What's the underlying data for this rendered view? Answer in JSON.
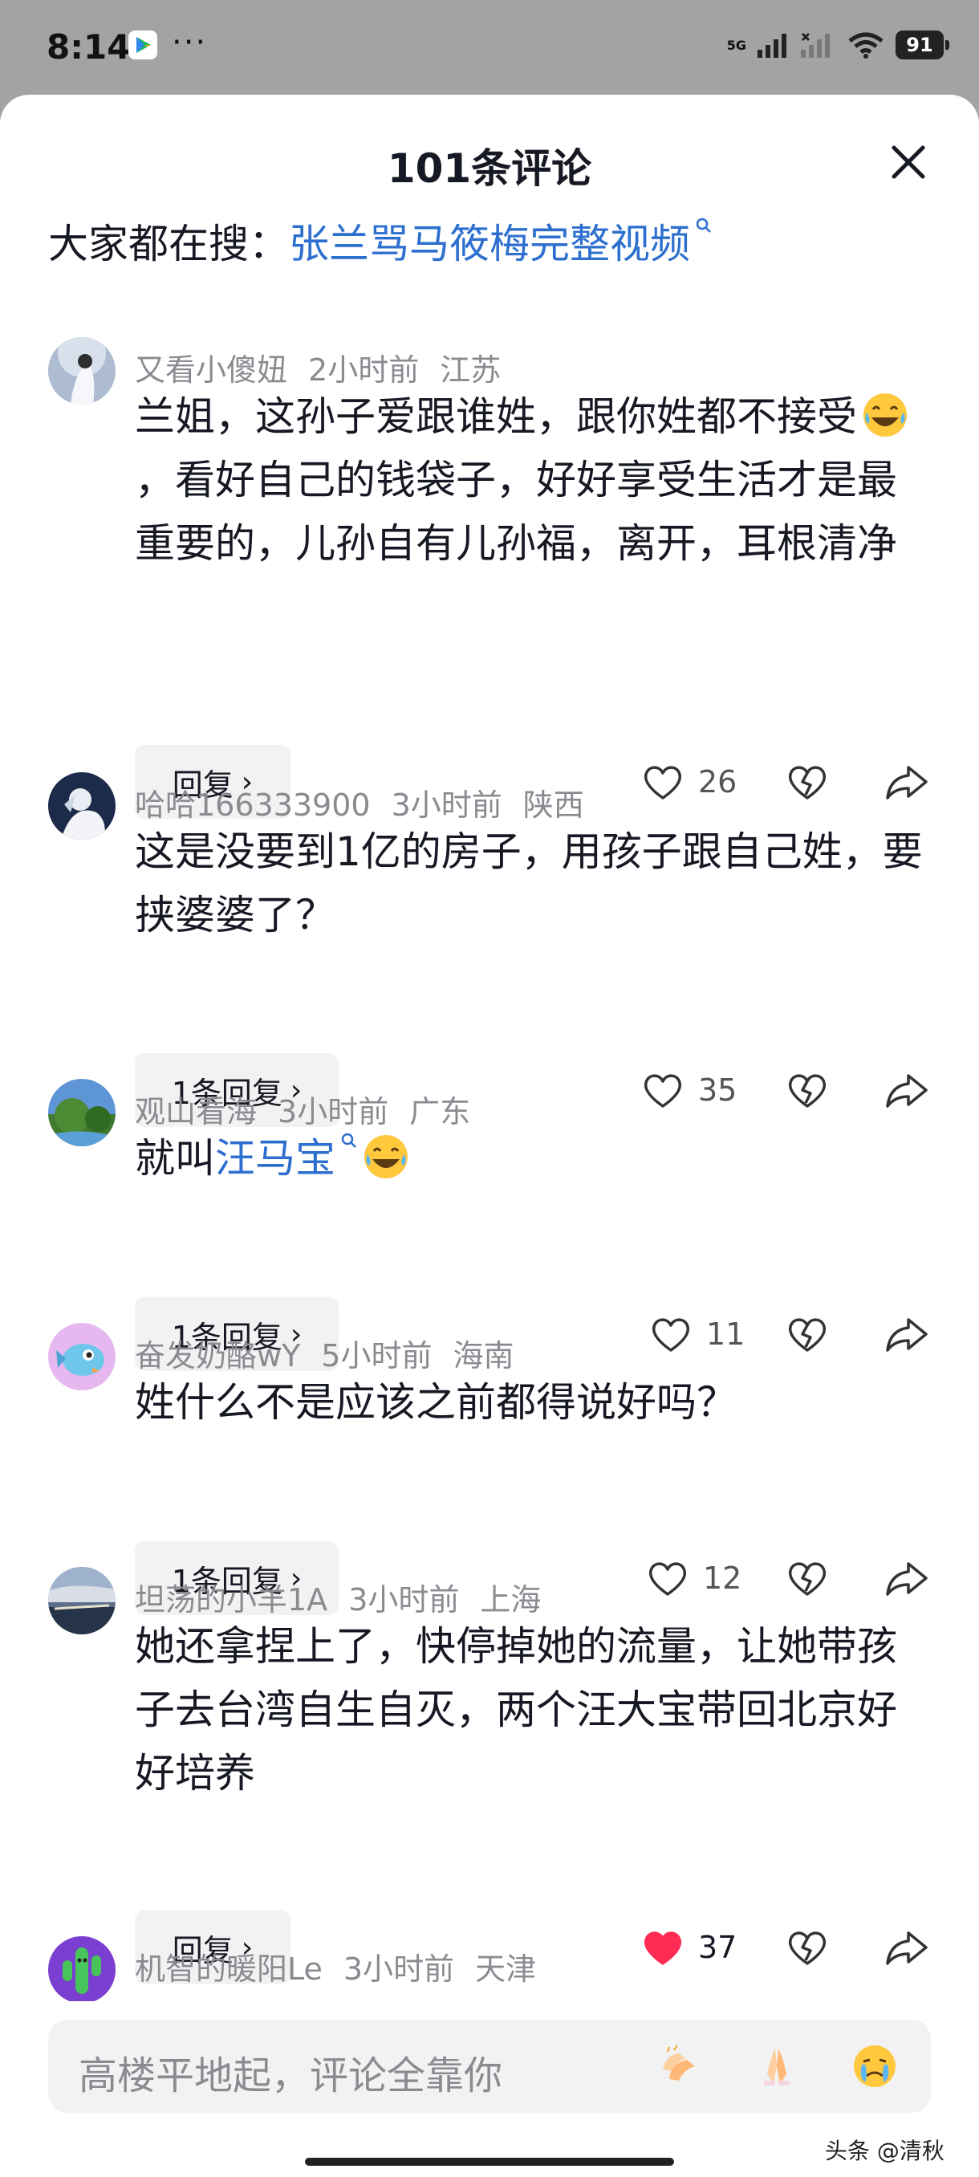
{
  "status_bar": {
    "time": "8:14",
    "network": "5G",
    "battery": "91"
  },
  "sheet": {
    "title": "101条评论"
  },
  "trending": {
    "prefix": "大家都在搜：",
    "query": "张兰骂马筱梅完整视频"
  },
  "comments": [
    {
      "user": "又看小傻妞",
      "time": "2小时前",
      "location": "江苏",
      "text_a": "兰姐，这孙子爱跟谁姓，跟你姓都不接受",
      "text_b": "，看好自己的钱袋子，好好享受生活才是最重要的，儿孙自有儿孙福，离开，耳根清净",
      "emoji": "laughing-tears-emoji",
      "reply_label": "回复",
      "likes": "26",
      "liked": false
    },
    {
      "user": "哈哈166333900",
      "time": "3小时前",
      "location": "陕西",
      "text": "这是没要到1亿的房子，用孩子跟自己姓，要挟婆婆了？",
      "reply_label": "1条回复",
      "likes": "35",
      "liked": false
    },
    {
      "user": "观山看海",
      "time": "3小时前",
      "location": "广东",
      "text_prefix": "就叫",
      "text_link": "汪马宝",
      "emoji": "laughing-tears-emoji",
      "reply_label": "1条回复",
      "likes": "11",
      "liked": false
    },
    {
      "user": "奋发奶酪wY",
      "time": "5小时前",
      "location": "海南",
      "text": "姓什么不是应该之前都得说好吗？",
      "reply_label": "1条回复",
      "likes": "12",
      "liked": false
    },
    {
      "user": "坦荡的小羊1A",
      "time": "3小时前",
      "location": "上海",
      "text": "她还拿捏上了，快停掉她的流量，让她带孩子去台湾自生自灭，两个汪大宝带回北京好好培养",
      "reply_label": "回复",
      "likes": "37",
      "liked": true
    },
    {
      "user": "机智的暖阳Le",
      "time": "3小时前",
      "location": "天津"
    }
  ],
  "input": {
    "placeholder": "高楼平地起，评论全靠你",
    "emojis": [
      "clap-emoji",
      "pray-emoji",
      "crying-emoji"
    ]
  },
  "watermark": "头条 @清秋",
  "colors": {
    "link": "#2d6fcf",
    "like_active": "#fe2c55",
    "meta": "#8a8b91",
    "bg": "#ffffff"
  }
}
